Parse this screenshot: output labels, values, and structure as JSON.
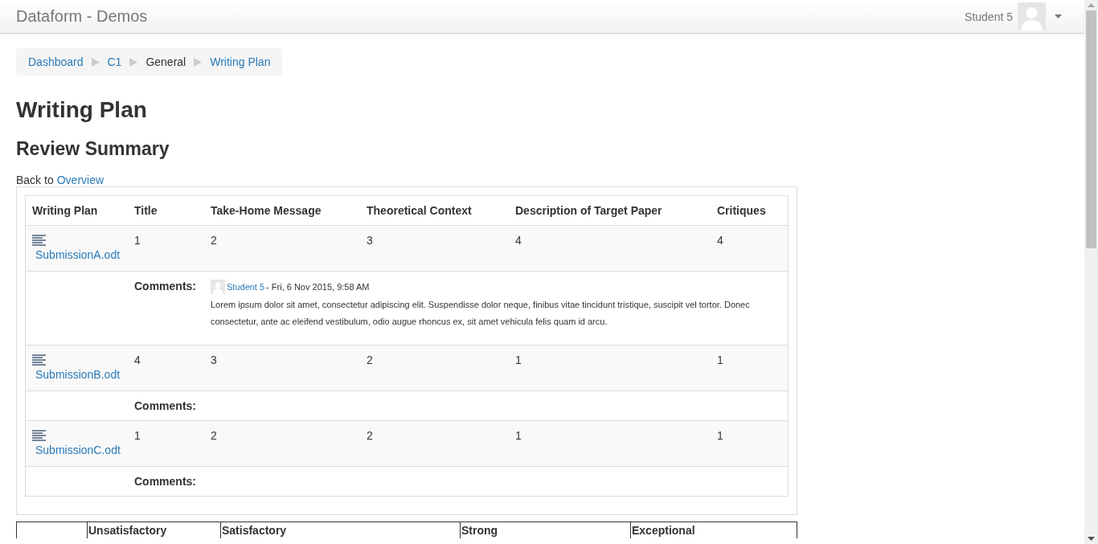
{
  "navbar": {
    "brand": "Dataform - Demos",
    "user": "Student 5"
  },
  "breadcrumb": [
    {
      "label": "Dashboard",
      "link": true
    },
    {
      "label": "C1",
      "link": true
    },
    {
      "label": "General",
      "link": false
    },
    {
      "label": "Writing Plan",
      "link": true
    }
  ],
  "page_title": "Writing Plan",
  "section_title": "Review Summary",
  "back": {
    "text": "Back to",
    "link": "Overview"
  },
  "table": {
    "columns": [
      "Writing Plan",
      "Title",
      "Take-Home Message",
      "Theoretical Context",
      "Description of Target Paper",
      "Critiques"
    ],
    "rows": [
      {
        "file": "SubmissionA.odt",
        "scores": [
          "1",
          "2",
          "3",
          "4",
          "4"
        ],
        "comments_label": "Comments:",
        "comment": {
          "author": "Student 5",
          "meta": "- Fri, 6 Nov 2015, 9:58 AM",
          "text": "Lorem ipsum dolor sit amet, consectetur adipiscing elit. Suspendisse dolor neque, finibus vitae tincidunt tristique, suscipit vel tortor. Donec consectetur, ante ac eleifend vestibulum, odio augue rhoncus ex, sit amet vehicula felis quam id arcu."
        }
      },
      {
        "file": "SubmissionB.odt",
        "scores": [
          "4",
          "3",
          "2",
          "1",
          "1"
        ],
        "comments_label": "Comments:"
      },
      {
        "file": "SubmissionC.odt",
        "scores": [
          "1",
          "2",
          "2",
          "1",
          "1"
        ],
        "comments_label": "Comments:"
      }
    ]
  },
  "rubric": {
    "columns": [
      "Unsatisfactory",
      "Satisfactory",
      "Strong",
      "Exceptional"
    ]
  }
}
